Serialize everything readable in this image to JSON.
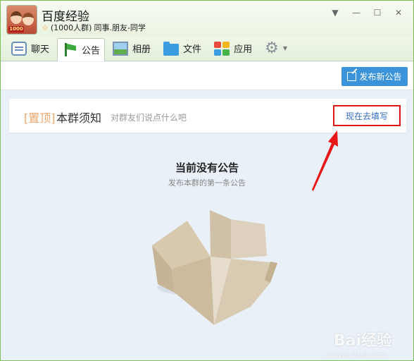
{
  "group": {
    "name": "百度经验",
    "member_count": "(1000人群)",
    "categories": "同事.朋友-同学",
    "avatar_badge": "1000"
  },
  "window_controls": [
    "▼",
    "—",
    "☐",
    "✕"
  ],
  "tabs": [
    {
      "label": "聊天",
      "icon": "chat-icon"
    },
    {
      "label": "公告",
      "icon": "flag-icon",
      "active": true
    },
    {
      "label": "相册",
      "icon": "photo-icon"
    },
    {
      "label": "文件",
      "icon": "folder-icon"
    },
    {
      "label": "应用",
      "icon": "apps-icon"
    }
  ],
  "toolbar": {
    "publish_label": "发布新公告"
  },
  "notice": {
    "tag": "[置顶]",
    "title": "本群须知",
    "hint": "对群友们说点什么吧",
    "fill_link": "现在去填写"
  },
  "empty_state": {
    "title": "当前没有公告",
    "subtitle": "发布本群的第一条公告"
  },
  "watermark": {
    "text": "Bai经验",
    "sub": "jingyan.baidu.com"
  },
  "colors": {
    "accent": "#3b94d9",
    "highlight_border": "#e01414",
    "tag_orange": "#f0a56a",
    "link_blue": "#2f6bbf"
  }
}
